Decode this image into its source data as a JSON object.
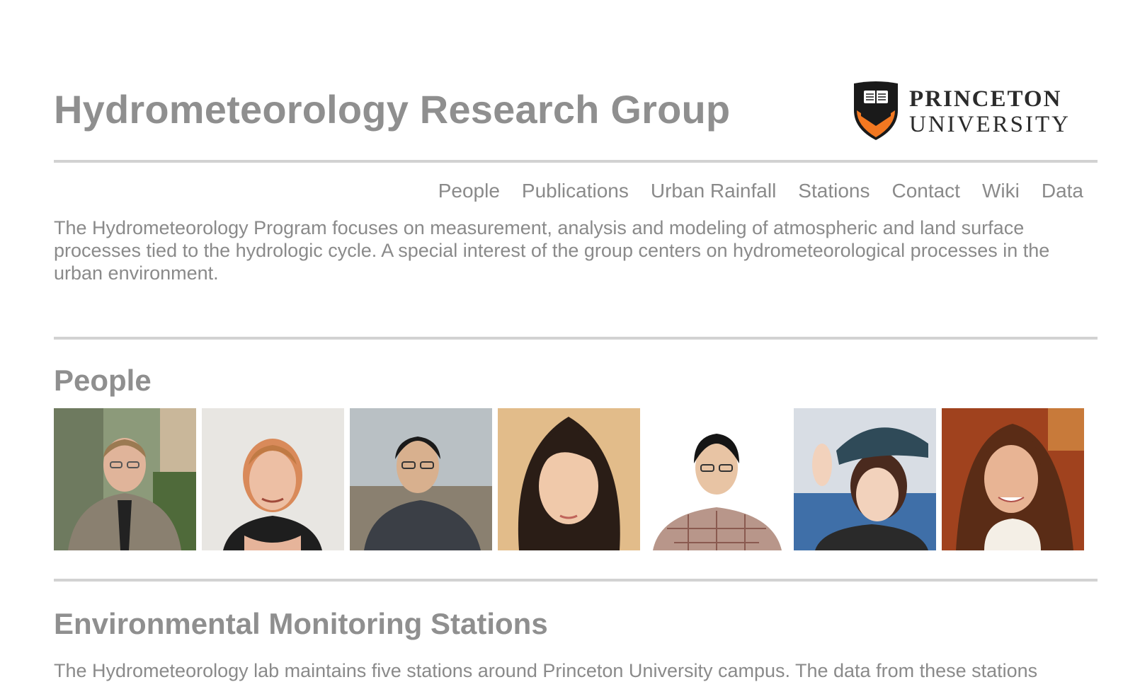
{
  "header": {
    "title": "Hydrometeorology Research Group",
    "logo": {
      "line1": "PRINCETON",
      "line2": "UNIVERSITY",
      "icon": "princeton-shield-icon",
      "colors": {
        "shield_black": "#1a1a1a",
        "shield_orange": "#f37821"
      }
    }
  },
  "nav": {
    "items": [
      {
        "label": "People"
      },
      {
        "label": "Publications"
      },
      {
        "label": "Urban Rainfall"
      },
      {
        "label": "Stations"
      },
      {
        "label": "Contact"
      },
      {
        "label": "Wiki"
      },
      {
        "label": "Data"
      }
    ]
  },
  "intro": {
    "text": "The Hydrometeorology Program focuses on measurement, analysis and modeling of atmospheric and land surface processes tied to the hydrologic cycle. A special interest of the group centers on hydrometeorological processes in the urban environment."
  },
  "people": {
    "heading": "People",
    "photos": [
      {
        "icon": "person-photo-1"
      },
      {
        "icon": "person-photo-2"
      },
      {
        "icon": "person-photo-3"
      },
      {
        "icon": "person-photo-4"
      },
      {
        "icon": "person-photo-5"
      },
      {
        "icon": "person-photo-6"
      },
      {
        "icon": "person-photo-7"
      }
    ]
  },
  "stations": {
    "heading": "Environmental Monitoring Stations",
    "text": "The Hydrometeorology lab maintains five stations around Princeton University campus. The data from these stations"
  },
  "colors": {
    "text": "#8a8a8a",
    "rule": "#d2d2d2",
    "background": "#ffffff"
  }
}
